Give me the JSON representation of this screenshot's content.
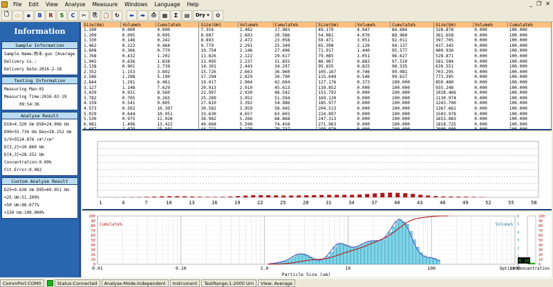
{
  "menu": [
    "File",
    "Edit",
    "View",
    "Analyse",
    "Measuure",
    "Windows",
    "Language",
    "Help"
  ],
  "toolbar": {
    "buttons": [
      "B",
      "R",
      "S",
      "C"
    ],
    "dry_label": "Dry"
  },
  "sidebar": {
    "title": "Information",
    "sample_head": "Sample Information",
    "sample_name": "Sample Name:粉末-gun [Average",
    "delivery_co": "Delivery Co.:",
    "delivery_date": "Delivery Date:2016-2-18",
    "testing_head": "Testing Information",
    "measuring_man": "Measuring Man:02",
    "measuring_time": "Measuring Time:2016-02-19",
    "measuring_clock": "09:54:36",
    "analyse_head": "Analyse Result",
    "d10": "D10=4.320 Um  D50=24.096 Um",
    "d90": "D90=55.734 Um  Dav=28.252 Um",
    "sv": "S/V=5524.876 cm²/cm³",
    "d32": "D[3,2]=10.860 Um",
    "d43": "D[4,3]=28.252 Um",
    "concentration": "Concentration:0.00%",
    "fit_error": "Fit Error:0.002",
    "custom_head": "Custom Analyse Result",
    "d25": "D25=9.638 Um  D95=69.051 Um",
    "lt25": "<25 Um:51.209%",
    "lt50": "<50 Um:86.677%",
    "lt150": "<150 Um:100.000%"
  },
  "table": {
    "headers": [
      "Size(Um)",
      "Volume%",
      "Cumulate%",
      "Size(Um)",
      "Volume%",
      "Cumulate%",
      "Size(Um)",
      "Volume%",
      "Cumulate%",
      "Size(Um)",
      "Volume%",
      "Cumulate%"
    ],
    "rows": [
      [
        "1.100",
        "0.000",
        "0.000",
        "7.354",
        "2.482",
        "17.983",
        "49.179",
        "4.947",
        "84.684",
        "328.878",
        "0.000",
        "100.000"
      ],
      [
        "1.209",
        "0.095",
        "0.095",
        "8.087",
        "2.603",
        "20.586",
        "54.081",
        "4.076",
        "88.960",
        "361.658",
        "0.000",
        "100.000"
      ],
      [
        "1.330",
        "0.146",
        "0.242",
        "8.893",
        "2.472",
        "23.058",
        "59.471",
        "3.051",
        "92.011",
        "397.705",
        "0.000",
        "100.000"
      ],
      [
        "1.462",
        "0.222",
        "0.464",
        "9.779",
        "2.291",
        "25.349",
        "65.398",
        "2.126",
        "94.137",
        "437.345",
        "0.000",
        "100.000"
      ],
      [
        "1.608",
        "0.306",
        "0.770",
        "10.754",
        "2.146",
        "27.496",
        "71.917",
        "1.440",
        "95.577",
        "480.936",
        "0.000",
        "100.000"
      ],
      [
        "1.768",
        "0.432",
        "1.202",
        "11.826",
        "2.122",
        "29.617",
        "79.085",
        "1.051",
        "96.627",
        "528.871",
        "0.000",
        "100.000"
      ],
      [
        "1.945",
        "0.636",
        "1.838",
        "13.005",
        "2.237",
        "31.855",
        "86.967",
        "0.883",
        "97.510",
        "581.584",
        "0.000",
        "100.000"
      ],
      [
        "2.138",
        "0.901",
        "2.739",
        "14.301",
        "2.443",
        "34.297",
        "95.635",
        "0.825",
        "98.335",
        "639.551",
        "0.000",
        "100.000"
      ],
      [
        "2.352",
        "1.153",
        "3.892",
        "15.726",
        "2.663",
        "36.960",
        "105.167",
        "0.746",
        "99.081",
        "703.295",
        "0.000",
        "100.000"
      ],
      [
        "2.586",
        "1.298",
        "5.190",
        "17.294",
        "2.829",
        "39.790",
        "115.649",
        "0.546",
        "99.627",
        "773.395",
        "0.000",
        "100.000"
      ],
      [
        "2.844",
        "1.291",
        "6.481",
        "19.017",
        "2.904",
        "42.694",
        "127.176",
        "0.373",
        "100.000",
        "850.480",
        "0.000",
        "100.000"
      ],
      [
        "3.127",
        "1.148",
        "7.629",
        "20.913",
        "2.919",
        "45.613",
        "139.852",
        "0.000",
        "100.000",
        "935.248",
        "0.000",
        "100.000"
      ],
      [
        "3.439",
        "0.931",
        "8.560",
        "22.997",
        "2.930",
        "48.542",
        "153.792",
        "0.000",
        "100.000",
        "1028.466",
        "0.000",
        "100.000"
      ],
      [
        "3.782",
        "0.705",
        "9.265",
        "25.289",
        "3.052",
        "51.594",
        "169.120",
        "0.000",
        "100.000",
        "1130.974",
        "0.000",
        "100.000"
      ],
      [
        "4.159",
        "0.541",
        "9.805",
        "27.810",
        "3.392",
        "54.986",
        "185.977",
        "0.000",
        "100.000",
        "1243.700",
        "0.000",
        "100.000"
      ],
      [
        "4.573",
        "0.502",
        "10.307",
        "30.582",
        "3.959",
        "58.945",
        "204.513",
        "0.000",
        "100.000",
        "1367.661",
        "0.000",
        "100.000"
      ],
      [
        "5.029",
        "0.644",
        "10.951",
        "33.630",
        "4.657",
        "63.602",
        "224.897",
        "0.000",
        "100.000",
        "1503.978",
        "0.000",
        "100.000"
      ],
      [
        "5.530",
        "0.975",
        "11.926",
        "36.982",
        "5.266",
        "68.868",
        "247.313",
        "0.000",
        "100.000",
        "1653.883",
        "0.000",
        "100.000"
      ],
      [
        "6.081",
        "1.496",
        "13.422",
        "40.668",
        "5.590",
        "74.458",
        "271.963",
        "0.000",
        "100.000",
        "1818.725",
        "0.000",
        "100.000"
      ],
      [
        "6.687",
        "2.079",
        "15.501",
        "44.721",
        "5.279",
        "79.737",
        "299.070",
        "0.000",
        "100.000",
        "2000.000",
        "0.000",
        "100.000"
      ]
    ]
  },
  "bar_chart": {
    "xticks": [
      "1",
      "4",
      "7",
      "10",
      "13",
      "16",
      "19",
      "22",
      "25",
      "28",
      "31",
      "34",
      "37",
      "40",
      "43",
      "46",
      "49",
      "52",
      "55",
      "58"
    ]
  },
  "chart_data": {
    "type": "bar",
    "xlabel": "Particle Size (um)",
    "left_label": "Cumulate%",
    "right_label": "Volume%",
    "right_axis_title": "Optics Concentration",
    "concentration_value": "0.10",
    "x_ticks": [
      "0.01",
      "0.10",
      "1.0",
      "10",
      "100",
      "1000"
    ],
    "ylim": [
      0,
      100
    ],
    "ylim_right": [
      0,
      6
    ],
    "sizes": [
      1.1,
      1.209,
      1.33,
      1.462,
      1.608,
      1.768,
      1.945,
      2.138,
      2.352,
      2.586,
      2.844,
      3.127,
      3.439,
      3.782,
      4.159,
      4.573,
      5.029,
      5.53,
      6.081,
      6.687,
      7.354,
      8.087,
      8.893,
      9.779,
      10.754,
      11.826,
      13.005,
      14.301,
      15.726,
      17.294,
      19.017,
      20.913,
      22.997,
      25.289,
      27.81,
      30.582,
      33.63,
      36.982,
      40.668,
      44.721,
      49.179,
      54.081,
      59.471,
      65.398,
      71.917,
      79.085,
      86.967,
      95.635,
      105.167,
      115.649,
      127.176
    ],
    "volume": [
      0,
      0.095,
      0.146,
      0.222,
      0.306,
      0.432,
      0.636,
      0.901,
      1.153,
      1.298,
      1.291,
      1.148,
      0.931,
      0.705,
      0.541,
      0.502,
      0.644,
      0.975,
      1.496,
      2.079,
      2.482,
      2.603,
      2.472,
      2.291,
      2.146,
      2.122,
      2.237,
      2.443,
      2.663,
      2.829,
      2.904,
      2.919,
      2.93,
      3.052,
      3.392,
      3.959,
      4.657,
      5.266,
      5.59,
      5.279,
      4.947,
      4.076,
      3.051,
      2.126,
      1.44,
      1.051,
      0.883,
      0.825,
      0.746,
      0.546,
      0.373
    ],
    "cumulate": [
      0,
      0.095,
      0.242,
      0.464,
      0.77,
      1.202,
      1.838,
      2.739,
      3.892,
      5.19,
      6.481,
      7.629,
      8.56,
      9.265,
      9.805,
      10.307,
      10.951,
      11.926,
      13.422,
      15.501,
      17.983,
      20.586,
      23.058,
      25.349,
      27.496,
      29.617,
      31.855,
      34.297,
      36.96,
      39.79,
      42.694,
      45.613,
      48.542,
      51.594,
      54.986,
      58.945,
      63.602,
      68.868,
      74.458,
      79.737,
      84.684,
      88.96,
      92.011,
      94.137,
      95.577,
      96.627,
      97.51,
      98.335,
      99.081,
      99.627,
      100
    ]
  },
  "status": {
    "port": "CommPort:COM0",
    "status": "Status:Connected",
    "mode": "Analyse-Mode:Independent",
    "instrument": "Instrument",
    "range": "TestRange:1-2000 Um",
    "view": "View: Average"
  }
}
